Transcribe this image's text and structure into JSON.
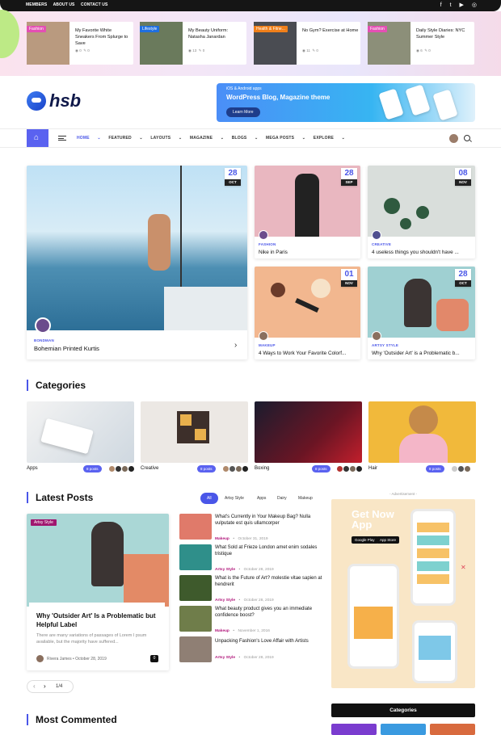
{
  "topbar": {
    "links": [
      "MEMBERS",
      "ABOUT US",
      "CONTACT US"
    ],
    "social_icons": [
      "facebook-icon",
      "twitter-icon",
      "youtube-icon",
      "instagram-icon"
    ]
  },
  "trending": [
    {
      "tag": "Fashion",
      "tag_color": "#e44fb4",
      "title": "My Favorite White Sneakers From Splurge to Save",
      "views": "0",
      "comments": "0",
      "img": "#b99a7f"
    },
    {
      "tag": "Lifestyle",
      "tag_color": "#1f6fe0",
      "title": "My Beauty Uniform: Natasha Janardan",
      "views": "13",
      "comments": "0",
      "img": "#6a7a5c"
    },
    {
      "tag": "Health & Fitne...",
      "tag_color": "#f07f1a",
      "title": "No Gym? Exercise at Home",
      "views": "11",
      "comments": "0",
      "img": "#4a4c52"
    },
    {
      "tag": "Fashion",
      "tag_color": "#e44fb4",
      "title": "Daily Style Diaries: NYC Summer Style",
      "views": "6",
      "comments": "0",
      "img": "#8c8f79"
    }
  ],
  "logo_text": "hsb",
  "banner": {
    "small": "iOS & Android apps",
    "headline": "WordPress Blog, Magazine theme",
    "button": "Learn More"
  },
  "nav": {
    "items": [
      "HOME",
      "FEATURED",
      "LAYOUTS",
      "MAGAZINE",
      "BLOGS",
      "MEGA POSTS",
      "EXPLORE"
    ]
  },
  "hero": {
    "main": {
      "day": "28",
      "month": "OCT",
      "cat": "BONDMAN",
      "title": "Bohemian Printed Kurtis"
    },
    "small": [
      {
        "day": "28",
        "month": "SEP",
        "cat": "FASHION",
        "title": "Nike in Paris"
      },
      {
        "day": "08",
        "month": "NOV",
        "cat": "CREATIVE",
        "title": "4 useless things you shouldn't have ..."
      },
      {
        "day": "01",
        "month": "NOV",
        "cat": "MAKEUP",
        "title": "4 Ways to Work Your Favorite Colorf..."
      },
      {
        "day": "28",
        "month": "OCT",
        "cat": "ARTSY STYLE",
        "title": "Why 'Outsider Art' is a Problematic b..."
      }
    ]
  },
  "categories": {
    "heading": "Categories",
    "items": [
      {
        "name": "Apps",
        "count": "8 posts"
      },
      {
        "name": "Creative",
        "count": "8 posts"
      },
      {
        "name": "Boxing",
        "count": "8 posts"
      },
      {
        "name": "Hair",
        "count": "8 posts"
      }
    ]
  },
  "latest": {
    "heading": "Latest Posts",
    "filters": [
      "All",
      "Artsy Style",
      "Apps",
      "Dairy",
      "Makeup"
    ],
    "feature": {
      "tag": "Artsy Style",
      "title": "Why 'Outsider Art' Is a Problematic but Helpful Label",
      "excerpt": "There are many variations of passages of Lorem I psum available, but the majority have suffered...",
      "author": "Rivera James",
      "date": "October 28, 2019",
      "comments": "0"
    },
    "list": [
      {
        "title": "What's Currently in Your Makeup Bag? Nulla vulputate est quis ullamcorper",
        "cat": "Makeup",
        "date": "October 31, 2019"
      },
      {
        "title": "What Sold at Frieze London amet enim sodales tristique",
        "cat": "Artsy Style",
        "date": "October 28, 2019"
      },
      {
        "title": "What is the Future of Art? molestie vitae sapien at hendrerit",
        "cat": "Artsy Style",
        "date": "October 28, 2019"
      },
      {
        "title": "What beauty product gives you an immediate confidence boost?",
        "cat": "Makeup",
        "date": "November 1, 2016"
      },
      {
        "title": "Unpacking Fashion's Love Affair with Artists",
        "cat": "Artsy Style",
        "date": "October 28, 2019"
      }
    ],
    "pager": "1/4"
  },
  "ad": {
    "label": "- Advertisement -",
    "headline": "Get Now App",
    "store1": "Google Play",
    "store2": "App Store"
  },
  "most_commented": "Most Commented",
  "sidebar_categories": "Categories"
}
